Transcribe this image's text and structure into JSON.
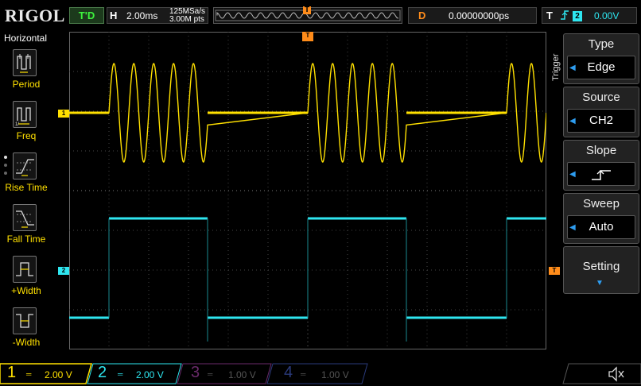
{
  "brand": "RIGOL",
  "top": {
    "run_state": "T'D",
    "h_label": "H",
    "timebase": "2.00ms",
    "sample_rate": "125MSa/s",
    "mem_depth": "3.00M pts",
    "trigger_pos_marker": "T",
    "delay_label": "D",
    "delay_value": "0.00000000ps",
    "trig_label": "T",
    "trig_edge_symbol": "⨍",
    "trig_source_num": "2",
    "trig_level": "0.00V"
  },
  "left_menu": {
    "title": "Horizontal",
    "items": [
      {
        "label": "Period",
        "icon": "period-icon"
      },
      {
        "label": "Freq",
        "icon": "frequency-icon"
      },
      {
        "label": "Rise Time",
        "icon": "rise-time-icon"
      },
      {
        "label": "Fall Time",
        "icon": "fall-time-icon"
      },
      {
        "label": "+Width",
        "icon": "positive-width-icon"
      },
      {
        "label": "-Width",
        "icon": "negative-width-icon"
      }
    ]
  },
  "right_menu": {
    "side_label": "Trigger",
    "type_title": "Type",
    "type_value": "Edge",
    "source_title": "Source",
    "source_value": "CH2",
    "slope_title": "Slope",
    "sweep_title": "Sweep",
    "sweep_value": "Auto",
    "setting_title": "Setting"
  },
  "channels": [
    {
      "num": "1",
      "scale": "2.00 V",
      "color": "#ffe000",
      "active": true
    },
    {
      "num": "2",
      "scale": "2.00 V",
      "color": "#2ee6f0",
      "active": true
    },
    {
      "num": "3",
      "scale": "1.00 V",
      "color": "#b02ab0",
      "active": false
    },
    {
      "num": "4",
      "scale": "1.00 V",
      "color": "#3a58d0",
      "active": false
    }
  ],
  "markers": {
    "ch1": "1",
    "ch2": "2",
    "trigger": "T"
  },
  "colors": {
    "ch1": "#ffe000",
    "ch2": "#2ee6f0",
    "trigger": "#ff8c1a",
    "grid": "#555555"
  }
}
